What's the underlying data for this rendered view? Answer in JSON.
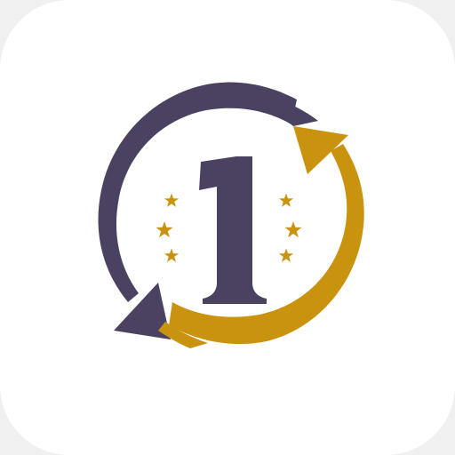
{
  "icon": {
    "numeral": "1",
    "star_count_per_side": 3,
    "colors": {
      "background": "#ffffff",
      "purple": "#4a4260",
      "gold": "#c9930f",
      "star": "#c9930f"
    },
    "icons": [
      "circular-arrows-icon",
      "number-one-icon",
      "star-icon"
    ]
  }
}
